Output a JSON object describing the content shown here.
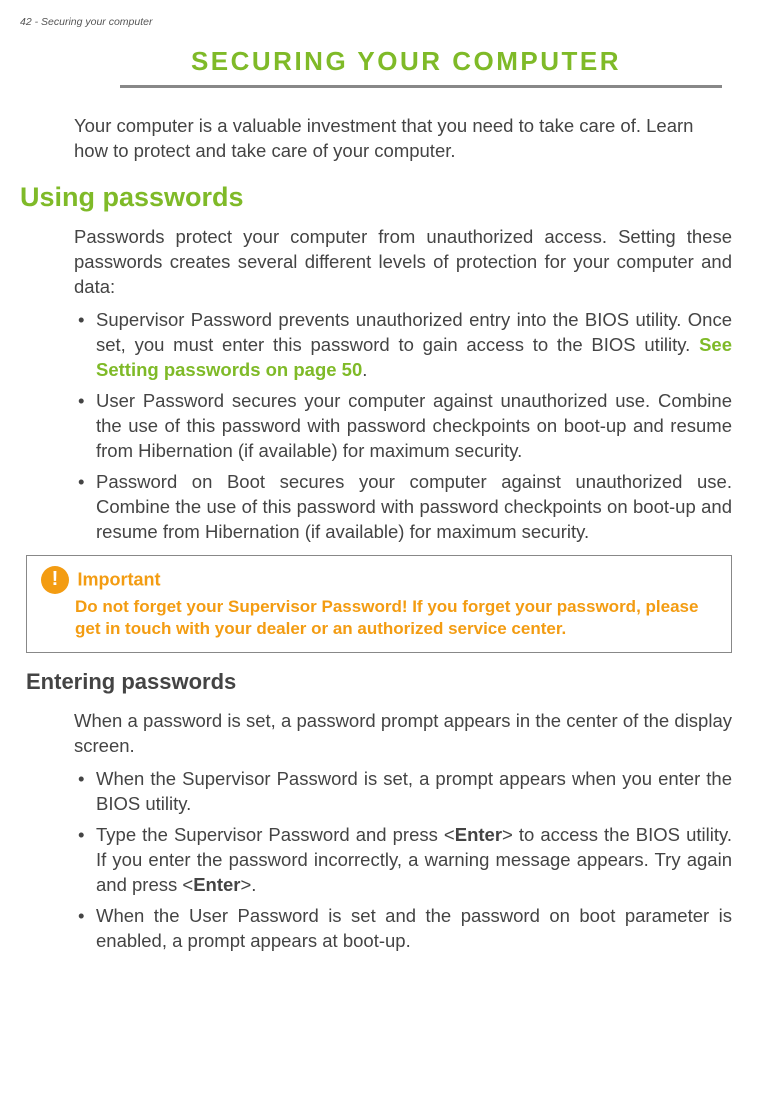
{
  "header": "42 - Securing your computer",
  "chapterTitle": "SECURING YOUR COMPUTER",
  "intro": "Your computer is a valuable investment that you need to take care of. Learn how to protect and take care of your computer.",
  "section1": {
    "heading": "Using passwords",
    "para": "Passwords protect your computer from unauthorized access. Setting these passwords creates several different levels of protection for your computer and data:",
    "bullets": {
      "b1_pre": "Supervisor Password prevents unauthorized entry into the BIOS utility. Once set, you must enter this password to gain access to the BIOS utility. ",
      "b1_link": "See Setting passwords on page 50",
      "b1_post": ".",
      "b2": "User Password secures your computer against unauthorized use. Combine the use of this password with password checkpoints on boot-up and resume from Hibernation (if available) for maximum security.",
      "b3": "Password on Boot secures your computer against unauthorized use. Combine the use of this password with password checkpoints on boot-up and resume from Hibernation (if available) for maximum security."
    }
  },
  "callout": {
    "iconGlyph": "!",
    "title": "Important",
    "body": "Do not forget your Supervisor Password! If you forget your password, please get in touch with your dealer or an authorized service center."
  },
  "section2": {
    "heading": "Entering passwords",
    "para": "When a password is set, a password prompt appears in the center of the display screen.",
    "bullets": {
      "b1": "When the Supervisor Password is set, a prompt appears when you enter the BIOS utility.",
      "b2_pre": "Type the Supervisor Password and press <",
      "b2_key1": "Enter",
      "b2_mid": "> to access the BIOS utility. If you enter the password incorrectly, a warning message appears. Try again and press <",
      "b2_key2": "Enter",
      "b2_post": ">.",
      "b3": "When the User Password is set and the password on boot parameter is enabled, a prompt appears at boot-up."
    }
  }
}
